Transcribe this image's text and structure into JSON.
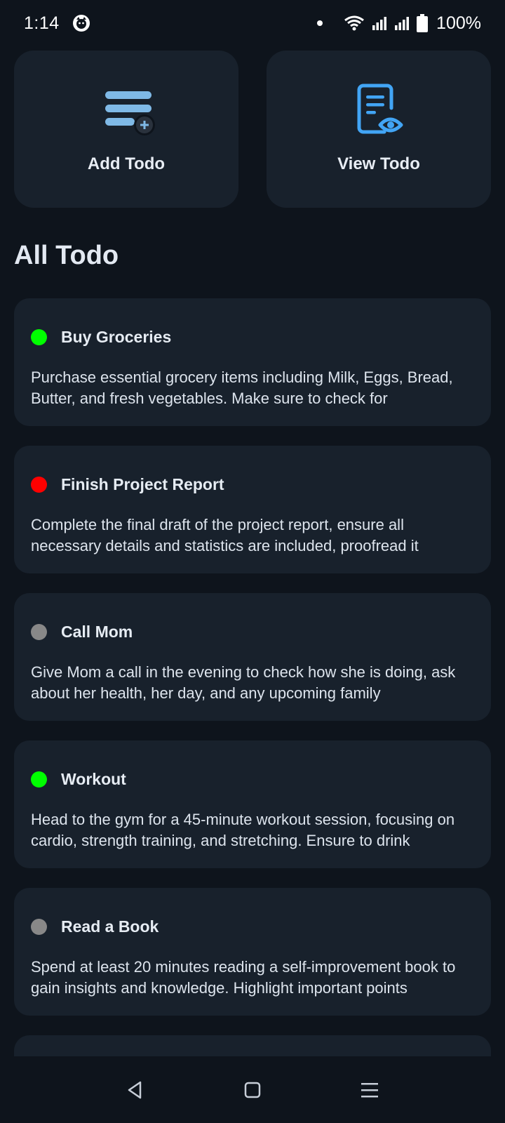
{
  "status_bar": {
    "time": "1:14",
    "battery_percent": "100%",
    "icons": [
      "cat-app-icon",
      "notification-dot",
      "wifi-icon",
      "signal-icon",
      "signal-icon",
      "battery-icon"
    ]
  },
  "actions": {
    "add": {
      "label": "Add Todo",
      "icon": "add-list-icon",
      "color": "#7fb9e6"
    },
    "view": {
      "label": "View Todo",
      "icon": "document-eye-icon",
      "color": "#42a5f5"
    }
  },
  "section_title": "All Todo",
  "status_colors": {
    "green": "#00ff00",
    "red": "#ff0000",
    "gray": "#888888"
  },
  "todos": [
    {
      "title": "Buy Groceries",
      "status_color": "#00ff00",
      "description": "Purchase essential grocery items including Milk, Eggs, Bread, Butter, and fresh vegetables. Make sure to check for"
    },
    {
      "title": "Finish Project Report",
      "status_color": "#ff0000",
      "description": "Complete the final draft of the project report, ensure all necessary details and statistics are included, proofread it"
    },
    {
      "title": "Call Mom",
      "status_color": "#888888",
      "description": "Give Mom a call in the evening to check how she is doing, ask about her health, her day, and any upcoming family"
    },
    {
      "title": "Workout",
      "status_color": "#00ff00",
      "description": "Head to the gym for a 45-minute workout session, focusing on cardio, strength training, and stretching. Ensure to drink"
    },
    {
      "title": "Read a Book",
      "status_color": "#888888",
      "description": "Spend at least 20 minutes reading a self-improvement book to gain insights and knowledge. Highlight important points"
    },
    {
      "title": "",
      "status_color": "#888888",
      "description": ""
    }
  ],
  "nav": {
    "icons": [
      "back-icon",
      "home-icon",
      "menu-icon"
    ]
  }
}
